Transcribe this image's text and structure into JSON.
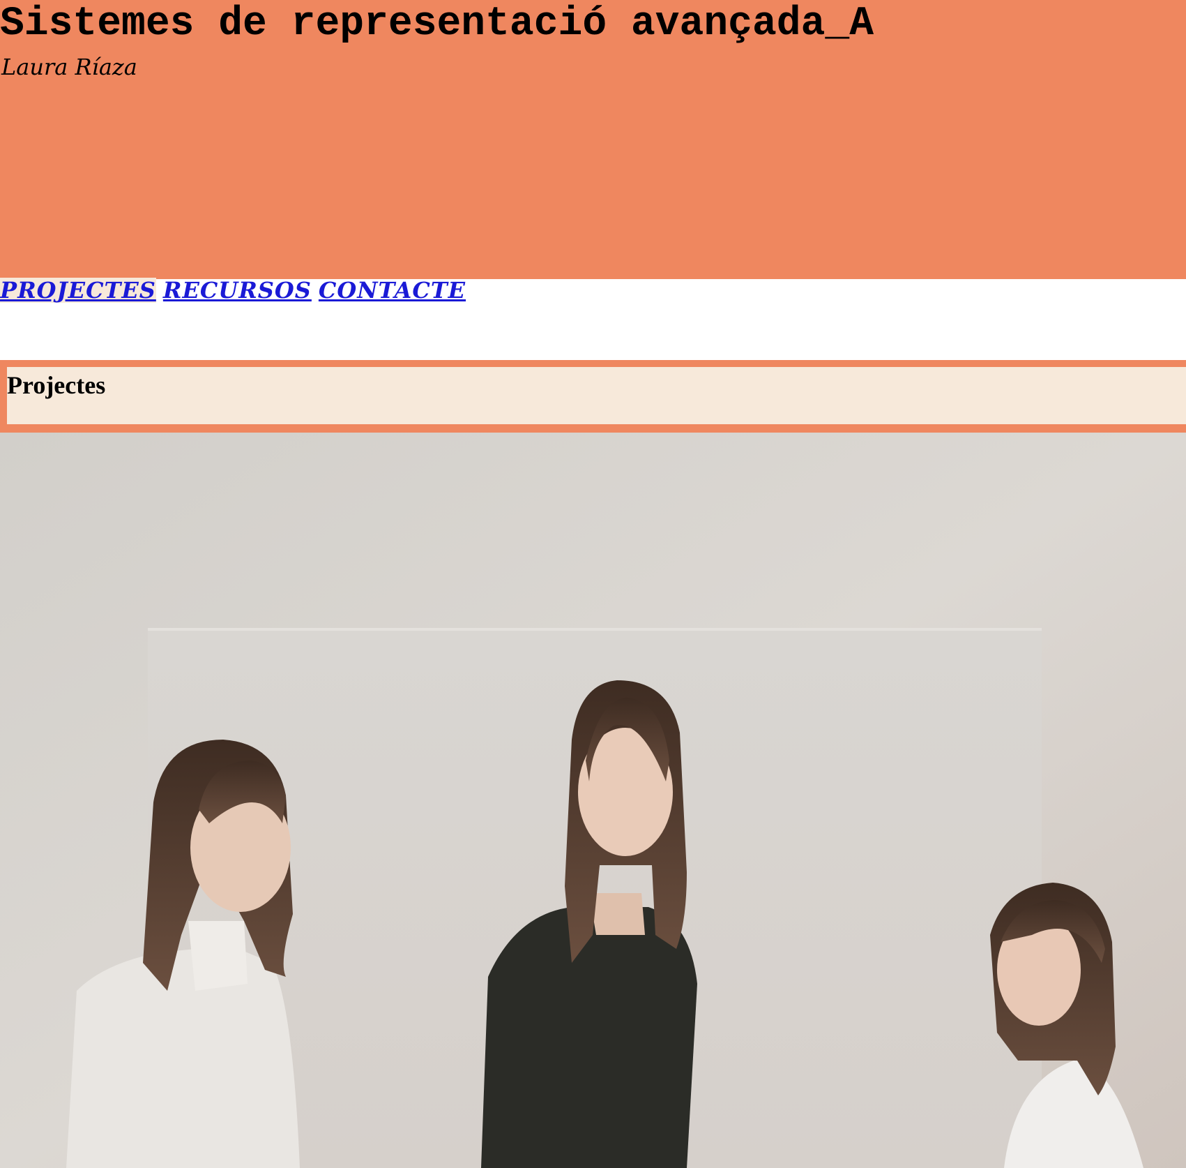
{
  "header": {
    "title": "Sistemes de representació avançada_A",
    "author": "Laura Ríaza"
  },
  "nav": {
    "items": [
      {
        "label": "PROJECTES",
        "active": true
      },
      {
        "label": "RECURSOS",
        "active": false
      },
      {
        "label": "CONTACTE",
        "active": false
      }
    ]
  },
  "section": {
    "title": "Projectes"
  },
  "hero": {
    "description": "photo-three-models"
  },
  "colors": {
    "accent": "#ef875f",
    "panel": "#f7e9da",
    "link": "#1a1ad6"
  }
}
